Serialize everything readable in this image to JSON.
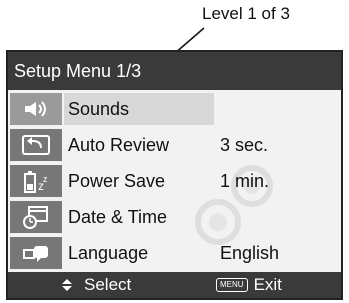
{
  "callout": {
    "text": "Level 1 of 3"
  },
  "screen": {
    "title": "Setup Menu 1/3",
    "items": [
      {
        "label": "Sounds",
        "value": "",
        "icon": "speaker-icon",
        "selected": true
      },
      {
        "label": "Auto Review",
        "value": "3 sec.",
        "icon": "review-arrow-icon",
        "selected": false
      },
      {
        "label": "Power Save",
        "value": "1 min.",
        "icon": "battery-sleep-icon",
        "selected": false
      },
      {
        "label": "Date & Time",
        "value": "",
        "icon": "calendar-clock-icon",
        "selected": false
      },
      {
        "label": "Language",
        "value": "English",
        "icon": "language-speech-icon",
        "selected": false
      }
    ],
    "bottom": {
      "select_label": "Select",
      "menu_key": "MENU",
      "exit_label": "Exit"
    }
  }
}
